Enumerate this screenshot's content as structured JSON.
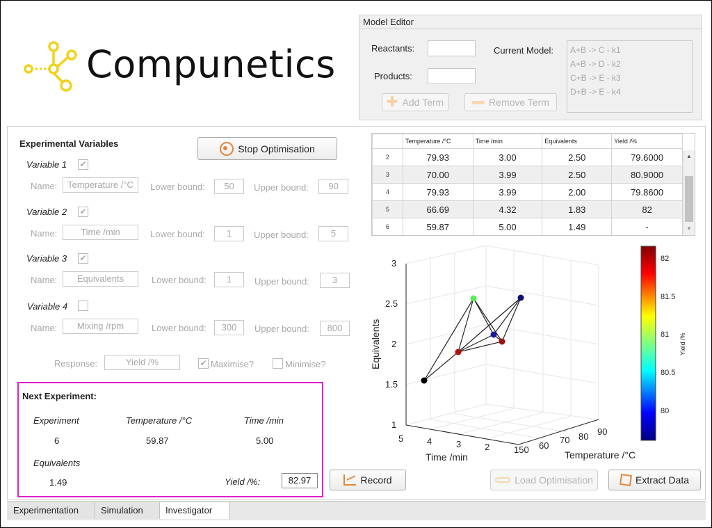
{
  "brand": {
    "name": "Compunetics",
    "accent": "#f2d21a"
  },
  "model_editor": {
    "title": "Model Editor",
    "reactants_label": "Reactants:",
    "products_label": "Products:",
    "current_model_label": "Current Model:",
    "model_terms": [
      "A+B -> C  - k1",
      "A+B -> D  - k2",
      "C+B -> E  - k3",
      "D+B -> E  - k4"
    ],
    "add_term_label": "Add Term",
    "remove_term_label": "Remove Term"
  },
  "experimental_variables": {
    "title": "Experimental Variables",
    "name_label": "Name:",
    "lower_label": "Lower bound:",
    "upper_label": "Upper bound:",
    "variables": [
      {
        "label": "Variable 1",
        "checked": true,
        "name": "Temperature /°C",
        "lower": "50",
        "upper": "90"
      },
      {
        "label": "Variable 2",
        "checked": true,
        "name": "Time /min",
        "lower": "1",
        "upper": "5"
      },
      {
        "label": "Variable 3",
        "checked": true,
        "name": "Equivalents",
        "lower": "1",
        "upper": "3"
      },
      {
        "label": "Variable 4",
        "checked": false,
        "name": "Mixing /rpm",
        "lower": "300",
        "upper": "800"
      }
    ],
    "response_label": "Response:",
    "response_value": "Yield /%",
    "maximise_label": "Maximise?",
    "minimise_label": "Minimise?"
  },
  "stop_button_label": "Stop Optimisation",
  "results_table": {
    "columns": [
      "",
      "Temperature /°C",
      "Time /min",
      "Equivalents",
      "Yield /%"
    ],
    "rows": [
      [
        "2",
        "79.93",
        "3.00",
        "2.50",
        "79.6000"
      ],
      [
        "3",
        "70.00",
        "3.99",
        "2.50",
        "80.9000"
      ],
      [
        "4",
        "79.93",
        "3.99",
        "2.00",
        "79.8600"
      ],
      [
        "5",
        "66.69",
        "4.32",
        "1.83",
        "82"
      ],
      [
        "6",
        "59.87",
        "5.00",
        "1.49",
        "-"
      ]
    ]
  },
  "next_experiment": {
    "title": "Next Experiment:",
    "experiment_label": "Experiment",
    "experiment_value": "6",
    "temperature_label": "Temperature /°C",
    "temperature_value": "59.87",
    "time_label": "Time /min",
    "time_value": "5.00",
    "equivalents_label": "Equivalents",
    "equivalents_value": "1.49",
    "yield_label": "Yield /%:",
    "yield_value": "82.97",
    "highlight_color": "#e020c8"
  },
  "buttons": {
    "record_label": "Record",
    "load_label": "Load Optimisation",
    "extract_label": "Extract Data"
  },
  "plot": {
    "zlabel": "Equivalents",
    "xlabel": "Time /min",
    "ylabel": "Temperature /°C",
    "z_ticks": [
      "1",
      "1.5",
      "2",
      "2.5",
      "3"
    ],
    "time_ticks": [
      "5",
      "4",
      "3",
      "2"
    ],
    "temp_ticks": [
      "150",
      "60",
      "70",
      "80",
      "90"
    ],
    "colorbar_label": "Yield /%",
    "colorbar_ticks": [
      "82",
      "81.5",
      "81",
      "80.5",
      "80"
    ]
  },
  "chart_data": {
    "type": "scatter",
    "xlabel": "Time /min",
    "ylabel": "Temperature /°C",
    "zlabel": "Equivalents",
    "points": [
      {
        "time": 5.0,
        "temperature": 59.87,
        "equivalents": 1.49,
        "color": "#000000"
      },
      {
        "time": 4.32,
        "temperature": 66.69,
        "equivalents": 1.83,
        "color": "#b01010"
      },
      {
        "time": 3.99,
        "temperature": 70.0,
        "equivalents": 2.5,
        "color": "#55ee55"
      },
      {
        "time": 3.99,
        "temperature": 79.93,
        "equivalents": 2.0,
        "color": "#1a1aa0"
      },
      {
        "time": 3.0,
        "temperature": 79.93,
        "equivalents": 2.5,
        "color": "#101070"
      },
      {
        "time": 3.5,
        "temperature": 85.0,
        "equivalents": 2.0,
        "color": "#a01010"
      }
    ],
    "colorbar_range": [
      79.6,
      82.2
    ]
  },
  "tabs": [
    "Experimentation",
    "Simulation",
    "Investigator"
  ],
  "active_tab": "Investigator"
}
